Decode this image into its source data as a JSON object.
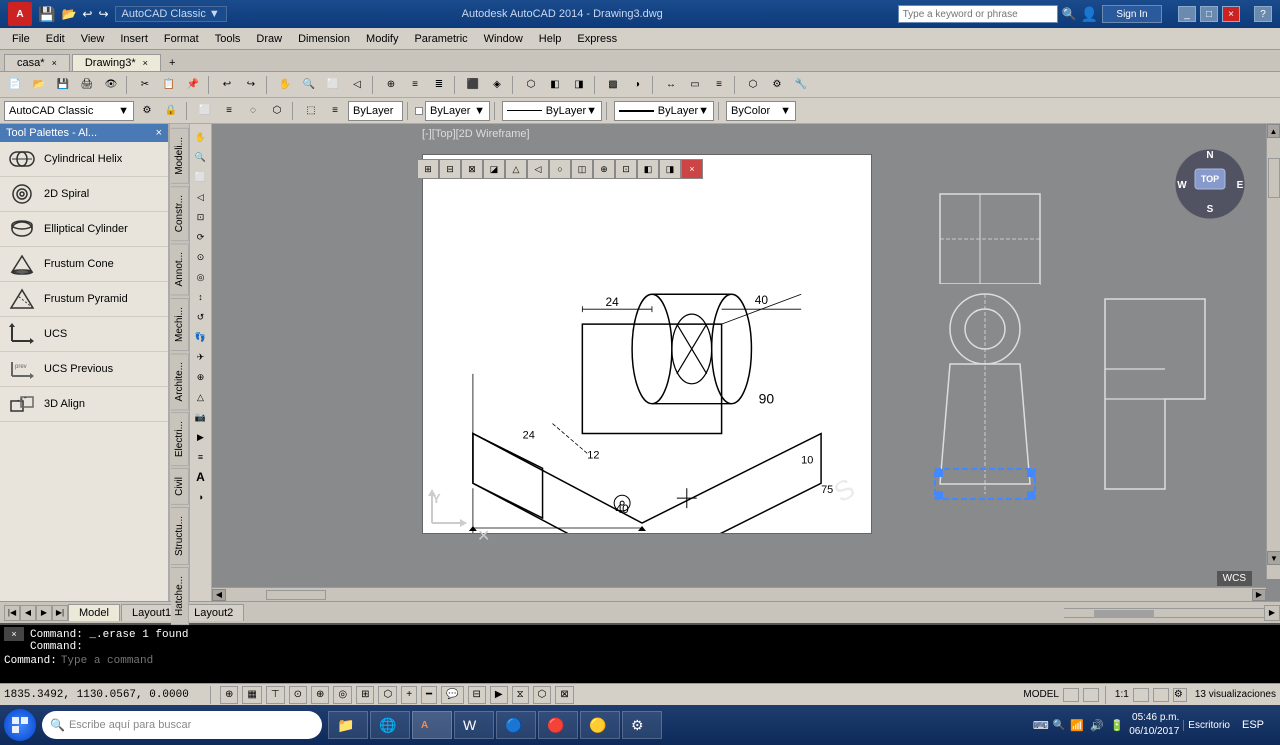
{
  "titlebar": {
    "app_title": "Autodesk AutoCAD 2014  -  Drawing3.dwg",
    "search_placeholder": "Type a keyword or phrase",
    "sign_in": "Sign In"
  },
  "menubar": {
    "items": [
      "File",
      "Edit",
      "View",
      "Insert",
      "Format",
      "Tools",
      "Draw",
      "Dimension",
      "Modify",
      "Parametric",
      "Window",
      "Help",
      "Express"
    ]
  },
  "tabs": {
    "items": [
      "casa*",
      "Drawing3*"
    ],
    "active": "Drawing3*"
  },
  "workspace": {
    "name": "AutoCAD Classic"
  },
  "toolbar": {
    "layer": "ByLayer",
    "color": "ByLayer",
    "linetype": "ByLayer",
    "lineweight": "ByLayer",
    "bycolor": "ByColor"
  },
  "tool_palettes": {
    "header": "Tool Palettes - Al...",
    "items": [
      {
        "name": "Cylindrical Helix",
        "icon": "helix"
      },
      {
        "name": "2D Spiral",
        "icon": "spiral"
      },
      {
        "name": "Elliptical Cylinder",
        "icon": "cylinder"
      },
      {
        "name": "Frustum Cone",
        "icon": "cone"
      },
      {
        "name": "Frustum Pyramid",
        "icon": "pyramid"
      },
      {
        "name": "UCS",
        "icon": "ucs"
      },
      {
        "name": "UCS Previous",
        "icon": "ucs-prev"
      },
      {
        "name": "3D Align",
        "icon": "align3d"
      }
    ]
  },
  "side_tabs": [
    "Modeli...",
    "Constr...",
    "Annot...",
    "Mechi...",
    "Archite...",
    "Electri...",
    "Civil",
    "Structu...",
    "Hatche..."
  ],
  "viewport": {
    "label": "[-][Top][2D Wireframe]"
  },
  "command": {
    "line1": "Command:  _.erase 1 found",
    "line2": "Command:",
    "prompt": "Command:",
    "placeholder": "Type a command"
  },
  "layout_tabs": {
    "items": [
      "Model",
      "Layout1",
      "Layout2"
    ]
  },
  "status": {
    "coordinates": "1835.3492, 1130.0567, 0.0000",
    "model": "MODEL",
    "scale": "1:1",
    "views_count": "13 visualizaciones"
  },
  "taskbar": {
    "start_label": "Escribe aquí para buscar",
    "time": "05:46 p.m.",
    "date": "06/10/2017",
    "keyboard": "ESP",
    "escritorio": "Escritorio"
  }
}
